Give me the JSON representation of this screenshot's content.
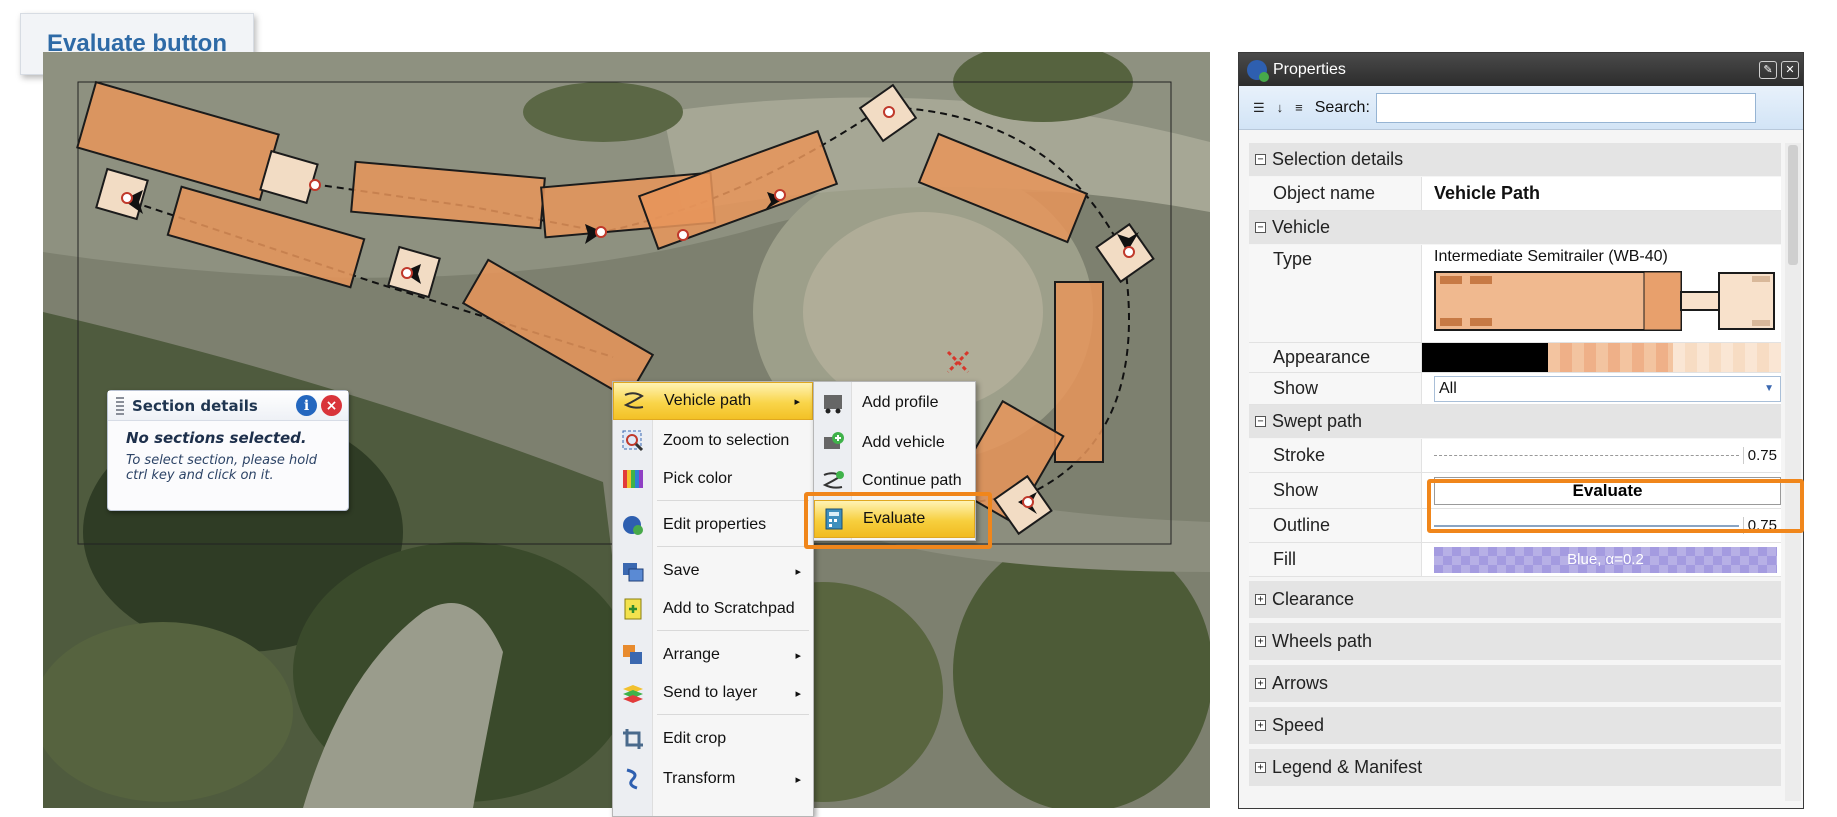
{
  "callout": {
    "label": "Evaluate button"
  },
  "section_details": {
    "title": "Section details",
    "message": "No sections selected.",
    "hint": "To select section, please hold ctrl key and click on it."
  },
  "context_menu": {
    "items": [
      {
        "label": "Vehicle path",
        "icon": "vehicle-path-icon",
        "submenu": true,
        "highlighted": true
      },
      {
        "label": "Zoom to selection",
        "icon": "zoom-icon"
      },
      {
        "label": "Pick color",
        "icon": "color-icon"
      },
      {
        "label": "Edit properties",
        "icon": "properties-icon"
      },
      {
        "label": "Save",
        "icon": "save-icon",
        "submenu": true
      },
      {
        "label": "Add to Scratchpad",
        "icon": "scratchpad-icon"
      },
      {
        "label": "Arrange",
        "icon": "arrange-icon",
        "submenu": true
      },
      {
        "label": "Send to layer",
        "icon": "layer-icon",
        "submenu": true
      },
      {
        "label": "Edit crop",
        "icon": "crop-icon"
      },
      {
        "label": "Transform",
        "icon": "transform-icon",
        "submenu": true
      }
    ],
    "arrow": "▸"
  },
  "submenu": {
    "items": [
      {
        "label": "Add profile",
        "icon": "add-profile-icon"
      },
      {
        "label": "Add vehicle",
        "icon": "add-vehicle-icon"
      },
      {
        "label": "Continue path",
        "icon": "continue-path-icon"
      },
      {
        "label": "Evaluate",
        "icon": "evaluate-icon",
        "highlighted": true
      }
    ]
  },
  "properties": {
    "title": "Properties",
    "search_label": "Search:",
    "search_value": "",
    "sections": {
      "selection": {
        "label": "Selection details",
        "toggle": "⊟"
      },
      "vehicle": {
        "label": "Vehicle",
        "toggle": "⊟"
      },
      "swept": {
        "label": "Swept path",
        "toggle": "⊟"
      }
    },
    "rows": {
      "object_name": {
        "key": "Object name",
        "value": "Vehicle Path"
      },
      "type": {
        "key": "Type",
        "value": "Intermediate Semitrailer (WB-40)"
      },
      "appearance": {
        "key": "Appearance"
      },
      "show_vehicle": {
        "key": "Show",
        "value": "All"
      },
      "stroke": {
        "key": "Stroke",
        "value": "0.75"
      },
      "show_swept": {
        "key": "Show",
        "button": "Evaluate"
      },
      "outline": {
        "key": "Outline",
        "value": "0.75"
      },
      "fill": {
        "key": "Fill",
        "value": "Blue, α=0.2"
      }
    },
    "collapsed_sections": [
      "Clearance",
      "Wheels path",
      "Arrows",
      "Speed",
      "Legend & Manifest"
    ],
    "collapsed_toggle": "⊞"
  },
  "colors": {
    "accent_orange": "#f0861b",
    "callout_text": "#2e6aa6",
    "vehicle_fill": "#e8955a",
    "menu_highlight": "#f9d54a"
  }
}
